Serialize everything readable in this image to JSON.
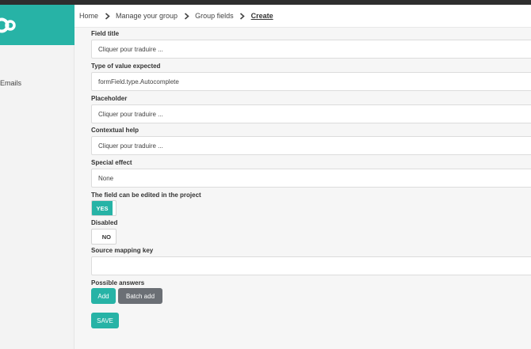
{
  "colors": {
    "accent": "#27b3a6",
    "secondary_button": "#6b6f75",
    "topbar": "#2e2e2e"
  },
  "sidebar": {
    "logo_icon": "brand-logo-icon",
    "items": [
      {
        "label": "Emails"
      }
    ]
  },
  "breadcrumb": {
    "items": [
      "Home",
      "Manage your group",
      "Group fields",
      "Create"
    ],
    "separator_icon": "chevron-right-icon"
  },
  "form": {
    "field_title": {
      "label": "Field title",
      "value": "Cliquer pour traduire ..."
    },
    "value_type": {
      "label": "Type of value expected",
      "value": "formField.type.Autocomplete"
    },
    "placeholder": {
      "label": "Placeholder",
      "value": "Cliquer pour traduire ..."
    },
    "contextual_help": {
      "label": "Contextual help",
      "value": "Cliquer pour traduire ..."
    },
    "special_effect": {
      "label": "Special effect",
      "value": "None"
    },
    "editable": {
      "label": "The field can be edited in the project",
      "state": "YES"
    },
    "disabled": {
      "label": "Disabled",
      "state": "NO"
    },
    "source_mapping_key": {
      "label": "Source mapping key",
      "value": ""
    },
    "possible_answers": {
      "label": "Possible answers",
      "add_label": "Add",
      "batch_add_label": "Batch add"
    },
    "save_label": "SAVE"
  }
}
